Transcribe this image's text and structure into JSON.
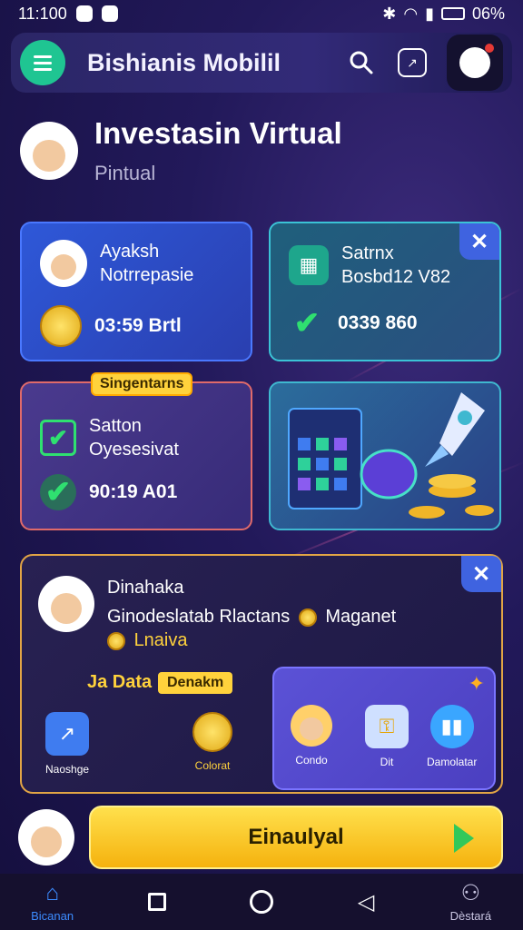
{
  "status_bar": {
    "time": "11:100",
    "battery": "06%"
  },
  "app_bar": {
    "title": "Bishianis Mobilil",
    "notification_dot": "#e53935"
  },
  "header": {
    "title": "Investasin Virtual",
    "subtitle": "Pintual"
  },
  "cards": [
    {
      "line1": "Ayaksh",
      "line2": "Notrrepasie",
      "amount": "03:59 Brtl"
    },
    {
      "line1": "Satrnx",
      "line2": "Bosbd12 V82",
      "amount": "0339 860"
    },
    {
      "tag": "Singentarns",
      "line1": "Satton",
      "line2": "Oyesesivat",
      "amount": "90:19 A01"
    }
  ],
  "big_card": {
    "name": "Dinahaka",
    "line1": "Ginodeslatab Rlactans",
    "line1_suffix": "Maganet",
    "line2": "Lnaiva",
    "data_label": "Ja Data",
    "data_pill": "Denakm",
    "tiles": [
      {
        "label": "Naoshge",
        "icon": "chart-icon",
        "color": "#3f7cf0"
      },
      {
        "label": "Colorat",
        "icon": "coin-icon",
        "color": "#e8b520"
      },
      {
        "label": "Condo",
        "icon": "avatar-icon",
        "color": "#ffd06a"
      },
      {
        "label": "Dit",
        "icon": "key-icon",
        "color": "#cfe0ff"
      },
      {
        "label": "Damolatar",
        "icon": "bars-icon",
        "color": "#3aa6ff"
      }
    ]
  },
  "cta": {
    "label": "Einaulyal"
  },
  "nav": [
    {
      "label": "Bicanan",
      "icon": "home-icon"
    },
    {
      "label": "",
      "icon": "recents-icon"
    },
    {
      "label": "",
      "icon": "home-circle-icon"
    },
    {
      "label": "",
      "icon": "back-icon"
    },
    {
      "label": "Dèstará",
      "icon": "profile-icon"
    }
  ],
  "colors": {
    "accent_green": "#1fc592",
    "accent_yellow": "#ffd23c",
    "accent_blue": "#3c8cff"
  }
}
